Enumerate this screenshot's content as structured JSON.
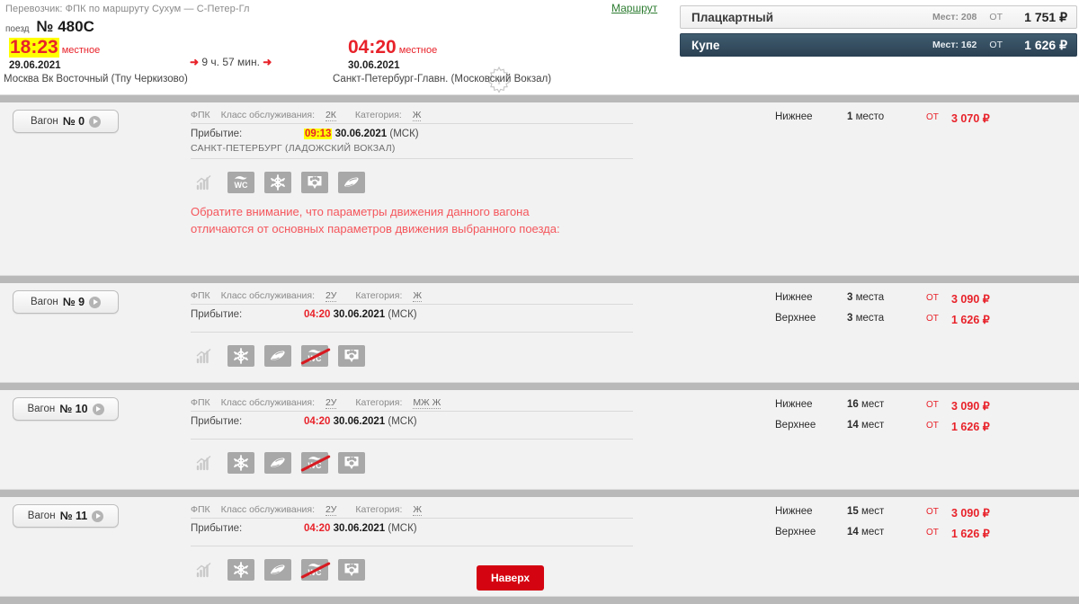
{
  "header": {
    "carrier_line": "Перевозчик: ФПК   по маршруту Сухум — С-Петер-Гл",
    "train_word": "поезд",
    "train_number": "№ 480С",
    "route_link": "Маршрут",
    "departure": {
      "time": "18:23",
      "suffix": "местное",
      "date": "29.06.2021",
      "station": "Москва Вк Восточный (Тпу Черкизово)"
    },
    "duration": "9 ч. 57 мин.",
    "arrival": {
      "time": "04:20",
      "suffix": "местное",
      "date": "30.06.2021",
      "station": "Санкт-Петербург-Главн. (Московский Вокзал)"
    },
    "info_icon_letter": "i"
  },
  "class_tabs": [
    {
      "name": "Плацкартный",
      "seats_label": "Мест: 208",
      "from_label": "от",
      "price": "1 751 ₽",
      "selected": false
    },
    {
      "name": "Купе",
      "seats_label": "Мест: 162",
      "from_label": "от",
      "price": "1 626 ₽",
      "selected": true
    }
  ],
  "labels": {
    "wagon_word": "Вагон",
    "carrier_short": "ФПК",
    "service_class_label": "Класс обслуживания:",
    "category_label": "Категория:",
    "arrival_label": "Прибытие:",
    "timezone": "(МСК)",
    "from_short": "от",
    "top_button": "Наверх"
  },
  "wagons": [
    {
      "number": "№ 0",
      "service_class": "2К",
      "category": "Ж",
      "arrival_time": "09:13",
      "arrival_time_highlighted": true,
      "arrival_date": "30.06.2021",
      "arrival_station": "САНКТ-ПЕТЕРБУРГ (ЛАДОЖСКИЙ ВОКЗАЛ)",
      "amenities": [
        "signal-icon",
        "wc-icon",
        "air-conditioning-icon",
        "pets-icon",
        "bedding-icon"
      ],
      "notice": "Обратите внимание, что параметры движения данного вагона отличаются от основных параметров движения выбранного поезда:",
      "prices": [
        {
          "berth": "Нижнее",
          "count": "1",
          "count_unit": "место",
          "from": "от",
          "price": "3 070 ₽"
        }
      ]
    },
    {
      "number": "№ 9",
      "service_class": "2У",
      "category": "Ж",
      "arrival_time": "04:20",
      "arrival_time_highlighted": false,
      "arrival_date": "30.06.2021",
      "arrival_station": "",
      "amenities": [
        "signal-icon",
        "air-conditioning-icon",
        "bedding-icon",
        "wc-unavailable-icon",
        "pets-icon"
      ],
      "notice": "",
      "prices": [
        {
          "berth": "Нижнее",
          "count": "3",
          "count_unit": "места",
          "from": "от",
          "price": "3 090 ₽"
        },
        {
          "berth": "Верхнее",
          "count": "3",
          "count_unit": "места",
          "from": "от",
          "price": "1 626 ₽"
        }
      ]
    },
    {
      "number": "№ 10",
      "service_class": "2У",
      "category": "МЖ Ж",
      "arrival_time": "04:20",
      "arrival_time_highlighted": false,
      "arrival_date": "30.06.2021",
      "arrival_station": "",
      "amenities": [
        "signal-icon",
        "air-conditioning-icon",
        "bedding-icon",
        "wc-unavailable-icon",
        "pets-icon"
      ],
      "notice": "",
      "prices": [
        {
          "berth": "Нижнее",
          "count": "16",
          "count_unit": "мест",
          "from": "от",
          "price": "3 090 ₽"
        },
        {
          "berth": "Верхнее",
          "count": "14",
          "count_unit": "мест",
          "from": "от",
          "price": "1 626 ₽"
        }
      ]
    },
    {
      "number": "№ 11",
      "service_class": "2У",
      "category": "Ж",
      "arrival_time": "04:20",
      "arrival_time_highlighted": false,
      "arrival_date": "30.06.2021",
      "arrival_station": "",
      "amenities": [
        "signal-icon",
        "air-conditioning-icon",
        "bedding-icon",
        "wc-unavailable-icon",
        "pets-icon"
      ],
      "notice": "",
      "has_top_button": true,
      "prices": [
        {
          "berth": "Нижнее",
          "count": "15",
          "count_unit": "мест",
          "from": "от",
          "price": "3 090 ₽"
        },
        {
          "berth": "Верхнее",
          "count": "14",
          "count_unit": "мест",
          "from": "от",
          "price": "1 626 ₽"
        }
      ]
    }
  ],
  "colors": {
    "accent_red": "#e8222a",
    "button_red": "#d40511",
    "highlight_yellow": "#ffff00",
    "tab_active_bg": "#2b4153",
    "link_green": "#2e7d32"
  }
}
